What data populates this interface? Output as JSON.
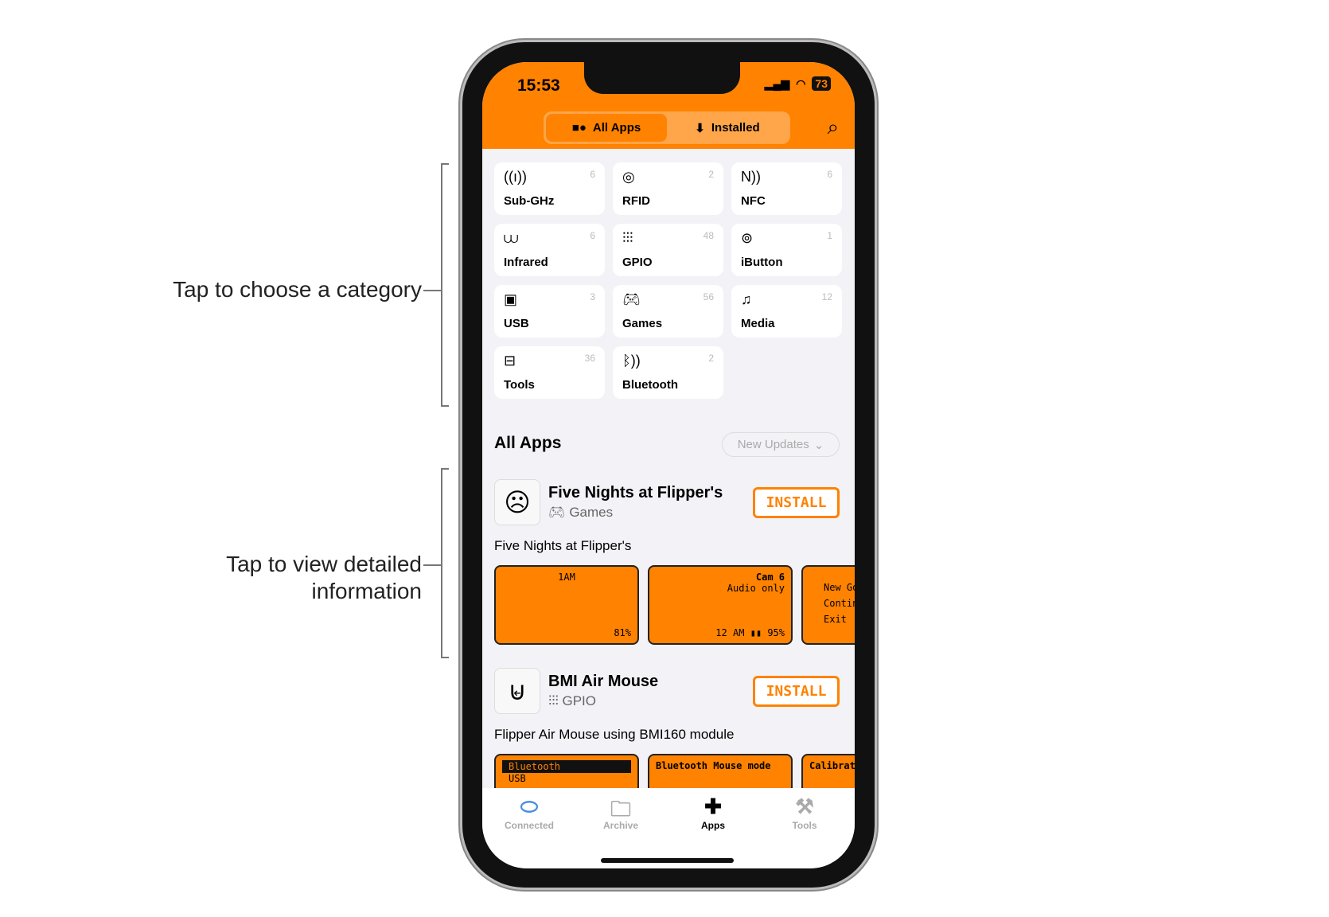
{
  "annotations": {
    "category": "Tap to choose a category",
    "detail_line1": "Tap to view detailed",
    "detail_line2": "information"
  },
  "status": {
    "time": "15:53",
    "battery": "73"
  },
  "segments": [
    {
      "label": "All Apps",
      "icon": "shapes-icon",
      "selected": true
    },
    {
      "label": "Installed",
      "icon": "download-box-icon",
      "selected": false
    }
  ],
  "categories": [
    {
      "label": "Sub-GHz",
      "count": "6",
      "icon": "((ı))"
    },
    {
      "label": "RFID",
      "count": "2",
      "icon": "◎"
    },
    {
      "label": "NFC",
      "count": "6",
      "icon": "N))"
    },
    {
      "label": "Infrared",
      "count": "6",
      "icon": "⩊"
    },
    {
      "label": "GPIO",
      "count": "48",
      "icon": "⫶⫶⫶"
    },
    {
      "label": "iButton",
      "count": "1",
      "icon": "⊚"
    },
    {
      "label": "USB",
      "count": "3",
      "icon": "▣"
    },
    {
      "label": "Games",
      "count": "56",
      "icon": "🎮︎"
    },
    {
      "label": "Media",
      "count": "12",
      "icon": "♫"
    },
    {
      "label": "Tools",
      "count": "36",
      "icon": "⊟"
    },
    {
      "label": "Bluetooth",
      "count": "2",
      "icon": "ᛒ))"
    }
  ],
  "section": {
    "title": "All Apps",
    "filter": "New Updates"
  },
  "apps": [
    {
      "title": "Five Nights at Flipper's",
      "category": "Games",
      "category_icon": "🎮︎",
      "description": "Five Nights at Flipper's",
      "install": "INSTALL",
      "shots": [
        {
          "top": "1AM",
          "bottom": "81%"
        },
        {
          "top": "Cam 6",
          "sub": "Audio only",
          "bottom": "12 AM  ▮▮ 95%"
        },
        {
          "top": "New Go",
          "sub": "Continu",
          "bottom": "Exit"
        }
      ]
    },
    {
      "title": "BMI Air Mouse",
      "category": "GPIO",
      "category_icon": "⫶⫶⫶",
      "description": "Flipper Air Mouse using BMI160 module",
      "install": "INSTALL",
      "shots": [
        {
          "top": "Bluetooth",
          "sub": "USB"
        },
        {
          "top": "Bluetooth Mouse mode"
        },
        {
          "top": "Calibrati"
        }
      ]
    }
  ],
  "tabs": [
    {
      "label": "Connected",
      "active": false
    },
    {
      "label": "Archive",
      "active": false
    },
    {
      "label": "Apps",
      "active": true
    },
    {
      "label": "Tools",
      "active": false
    }
  ],
  "colors": {
    "accent": "#ff8200",
    "background": "#f2f2f7",
    "connected": "#4a8ee0"
  }
}
